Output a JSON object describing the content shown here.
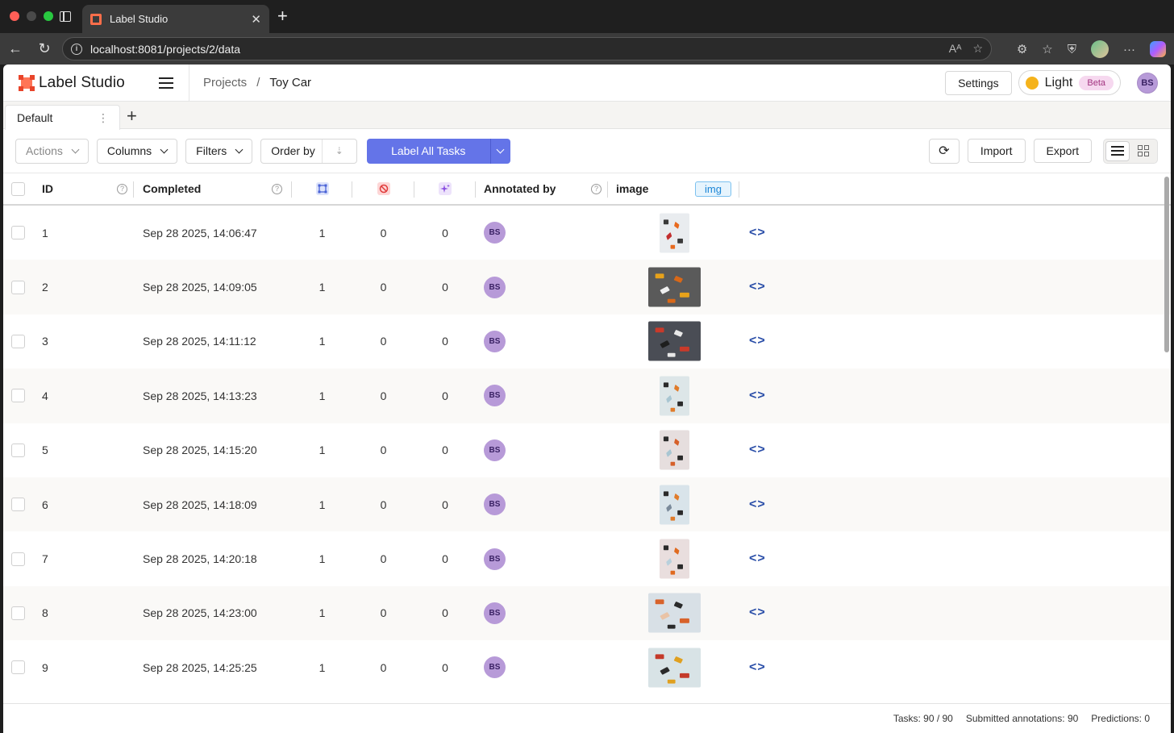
{
  "browser": {
    "tab_title": "Label Studio",
    "url": "localhost:8081/projects/2/data"
  },
  "app": {
    "brand": "Label Studio",
    "breadcrumb": {
      "root": "Projects",
      "separator": "/",
      "current": "Toy Car"
    },
    "settings_label": "Settings",
    "theme_label": "Light",
    "beta_badge": "Beta",
    "user_initials": "BS"
  },
  "view_tabs": [
    {
      "label": "Default"
    }
  ],
  "toolbar": {
    "actions_label": "Actions",
    "columns_label": "Columns",
    "filters_label": "Filters",
    "order_by_label": "Order by",
    "label_all_label": "Label All Tasks",
    "import_label": "Import",
    "export_label": "Export"
  },
  "table": {
    "headers": {
      "id": "ID",
      "completed": "Completed",
      "annotated_by": "Annotated by",
      "image": "image",
      "image_tag": "img"
    },
    "rows": [
      {
        "id": "1",
        "completed": "Sep 28 2025, 14:06:47",
        "annotations": "1",
        "cancelled": "0",
        "predictions": "0",
        "annotator": "BS",
        "thumb": "tall"
      },
      {
        "id": "2",
        "completed": "Sep 28 2025, 14:09:05",
        "annotations": "1",
        "cancelled": "0",
        "predictions": "0",
        "annotator": "BS",
        "thumb": "wide"
      },
      {
        "id": "3",
        "completed": "Sep 28 2025, 14:11:12",
        "annotations": "1",
        "cancelled": "0",
        "predictions": "0",
        "annotator": "BS",
        "thumb": "wide"
      },
      {
        "id": "4",
        "completed": "Sep 28 2025, 14:13:23",
        "annotations": "1",
        "cancelled": "0",
        "predictions": "0",
        "annotator": "BS",
        "thumb": "tall"
      },
      {
        "id": "5",
        "completed": "Sep 28 2025, 14:15:20",
        "annotations": "1",
        "cancelled": "0",
        "predictions": "0",
        "annotator": "BS",
        "thumb": "tall"
      },
      {
        "id": "6",
        "completed": "Sep 28 2025, 14:18:09",
        "annotations": "1",
        "cancelled": "0",
        "predictions": "0",
        "annotator": "BS",
        "thumb": "tall"
      },
      {
        "id": "7",
        "completed": "Sep 28 2025, 14:20:18",
        "annotations": "1",
        "cancelled": "0",
        "predictions": "0",
        "annotator": "BS",
        "thumb": "tall"
      },
      {
        "id": "8",
        "completed": "Sep 28 2025, 14:23:00",
        "annotations": "1",
        "cancelled": "0",
        "predictions": "0",
        "annotator": "BS",
        "thumb": "wide"
      },
      {
        "id": "9",
        "completed": "Sep 28 2025, 14:25:25",
        "annotations": "1",
        "cancelled": "0",
        "predictions": "0",
        "annotator": "BS",
        "thumb": "wide"
      }
    ]
  },
  "footer": {
    "tasks": "Tasks: 90 / 90",
    "submitted": "Submitted annotations: 90",
    "predictions": "Predictions: 0"
  },
  "colors": {
    "accent": "#6474e8",
    "avatar": "#b79ad8",
    "brand": "#ff7557"
  }
}
